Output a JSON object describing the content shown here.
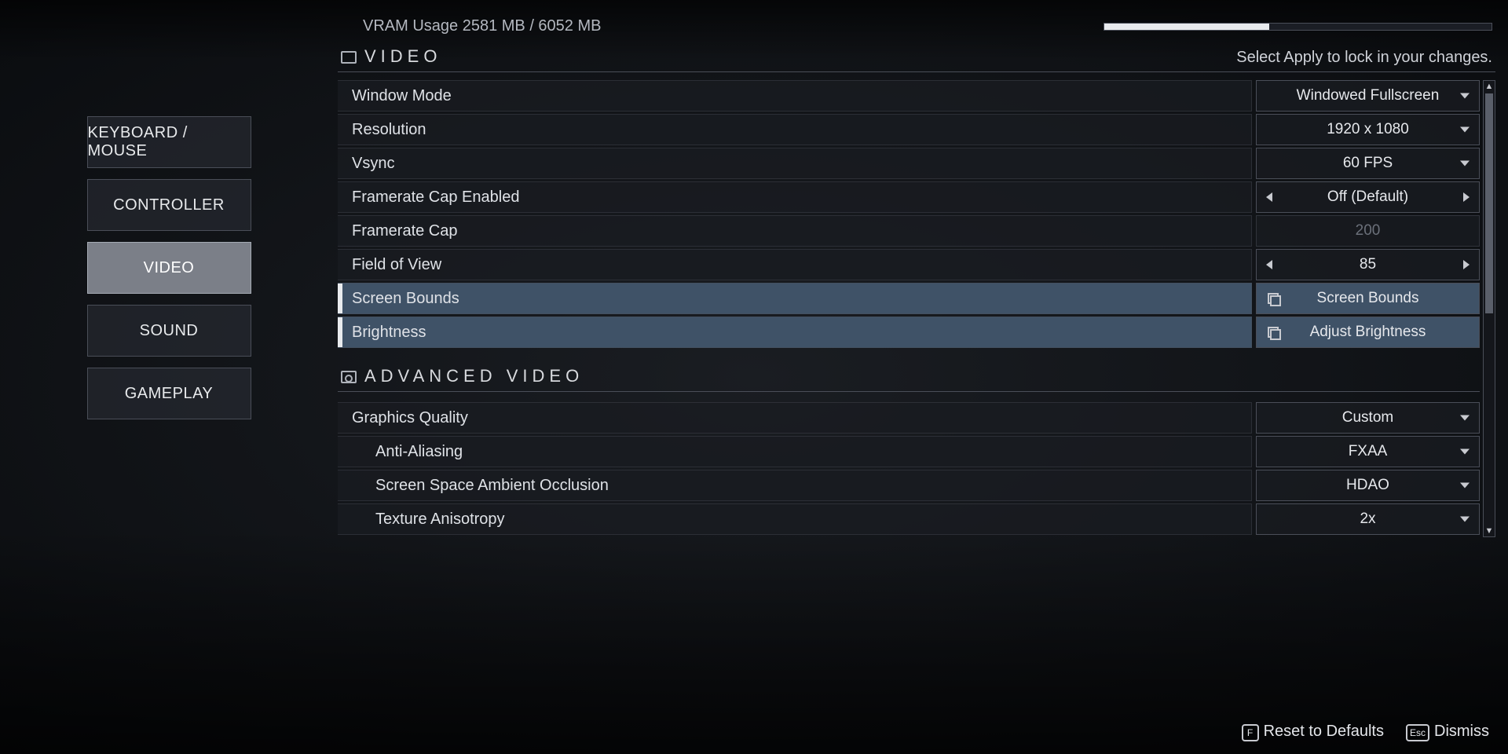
{
  "sidebar": {
    "tabs": [
      {
        "label": "KEYBOARD / MOUSE",
        "active": false
      },
      {
        "label": "CONTROLLER",
        "active": false
      },
      {
        "label": "VIDEO",
        "active": true
      },
      {
        "label": "SOUND",
        "active": false
      },
      {
        "label": "GAMEPLAY",
        "active": false
      }
    ]
  },
  "vram": {
    "text": "VRAM Usage 2581 MB / 6052 MB",
    "used": 2581,
    "total": 6052,
    "fill_percent": 42.6
  },
  "section_video": {
    "title": "VIDEO",
    "hint": "Select Apply to lock in your changes."
  },
  "section_advanced": {
    "title": "ADVANCED VIDEO"
  },
  "settings": {
    "window_mode": {
      "label": "Window Mode",
      "value": "Windowed Fullscreen",
      "kind": "dropdown"
    },
    "resolution": {
      "label": "Resolution",
      "value": "1920 x 1080",
      "kind": "dropdown"
    },
    "vsync": {
      "label": "Vsync",
      "value": "60 FPS",
      "kind": "dropdown"
    },
    "fr_cap_enabled": {
      "label": "Framerate Cap Enabled",
      "value": "Off (Default)",
      "kind": "stepper"
    },
    "fr_cap": {
      "label": "Framerate Cap",
      "value": "200",
      "kind": "disabled"
    },
    "fov": {
      "label": "Field of View",
      "value": "85",
      "kind": "stepper"
    },
    "screen_bounds": {
      "label": "Screen Bounds",
      "value": "Screen Bounds",
      "kind": "panel"
    },
    "brightness": {
      "label": "Brightness",
      "value": "Adjust Brightness",
      "kind": "panel"
    },
    "graphics_quality": {
      "label": "Graphics Quality",
      "value": "Custom",
      "kind": "dropdown"
    },
    "anti_aliasing": {
      "label": "Anti-Aliasing",
      "value": "FXAA",
      "kind": "dropdown"
    },
    "ssao": {
      "label": "Screen Space Ambient Occlusion",
      "value": "HDAO",
      "kind": "dropdown"
    },
    "tex_aniso": {
      "label": "Texture Anisotropy",
      "value": "2x",
      "kind": "dropdown"
    }
  },
  "footer": {
    "reset_key": "F",
    "reset_label": "Reset to Defaults",
    "dismiss_key": "Esc",
    "dismiss_label": "Dismiss"
  }
}
